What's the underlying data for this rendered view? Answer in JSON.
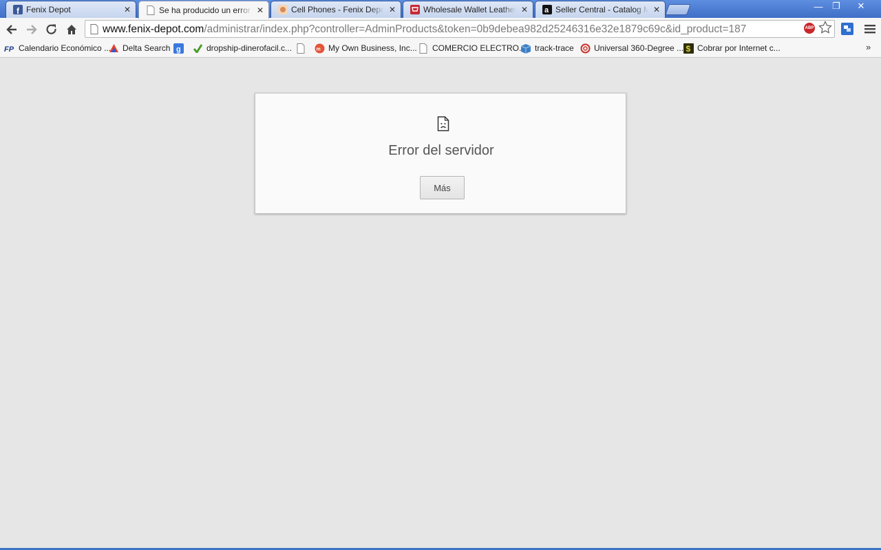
{
  "tabs": [
    {
      "title": "Fenix Depot",
      "icon": "facebook-icon",
      "active": false
    },
    {
      "title": "Se ha producido un error al c",
      "icon": "page-icon",
      "active": true
    },
    {
      "title": "Cell Phones - Fenix Depot",
      "icon": "site-icon",
      "active": false
    },
    {
      "title": "Wholesale Wallet Leather Ca",
      "icon": "cart-icon",
      "active": false
    },
    {
      "title": "Seller Central - Catalog Mana",
      "icon": "amazon-icon",
      "active": false
    }
  ],
  "tab_close_glyph": "✕",
  "window_controls": {
    "minimize": "—",
    "maximize": "❐",
    "close": "✕"
  },
  "omnibox": {
    "host": "www.fenix-depot.com",
    "path": "/administrar/index.php?controller=AdminProducts&token=0b9debea982d25246316e32e1879c69c&id_product=187"
  },
  "abp_label": "ABP",
  "bookmarks": [
    {
      "label": "Calendario Económico ...",
      "icon": "fp-icon"
    },
    {
      "label": "Delta Search",
      "icon": "delta-icon"
    },
    {
      "label": "",
      "icon": "google-icon"
    },
    {
      "label": "dropship-dinerofacil.c...",
      "icon": "leaf-icon"
    },
    {
      "label": "",
      "icon": "blank-page-icon"
    },
    {
      "label": "My Own Business, Inc...",
      "icon": "mob-icon"
    },
    {
      "label": "COMERCIO ELECTRO...",
      "icon": "page-icon"
    },
    {
      "label": "track-trace",
      "icon": "box-icon"
    },
    {
      "label": "Universal 360-Degree ...",
      "icon": "swirl-icon"
    },
    {
      "label": "Cobrar por Internet c...",
      "icon": "dollar-icon"
    }
  ],
  "bookmarks_overflow": "»",
  "error": {
    "title": "Error del servidor",
    "button": "Más"
  },
  "colors": {
    "tabstrip": "#4d7cd3",
    "page_background": "#e6e6e6",
    "dialog_background": "#fafafa"
  }
}
